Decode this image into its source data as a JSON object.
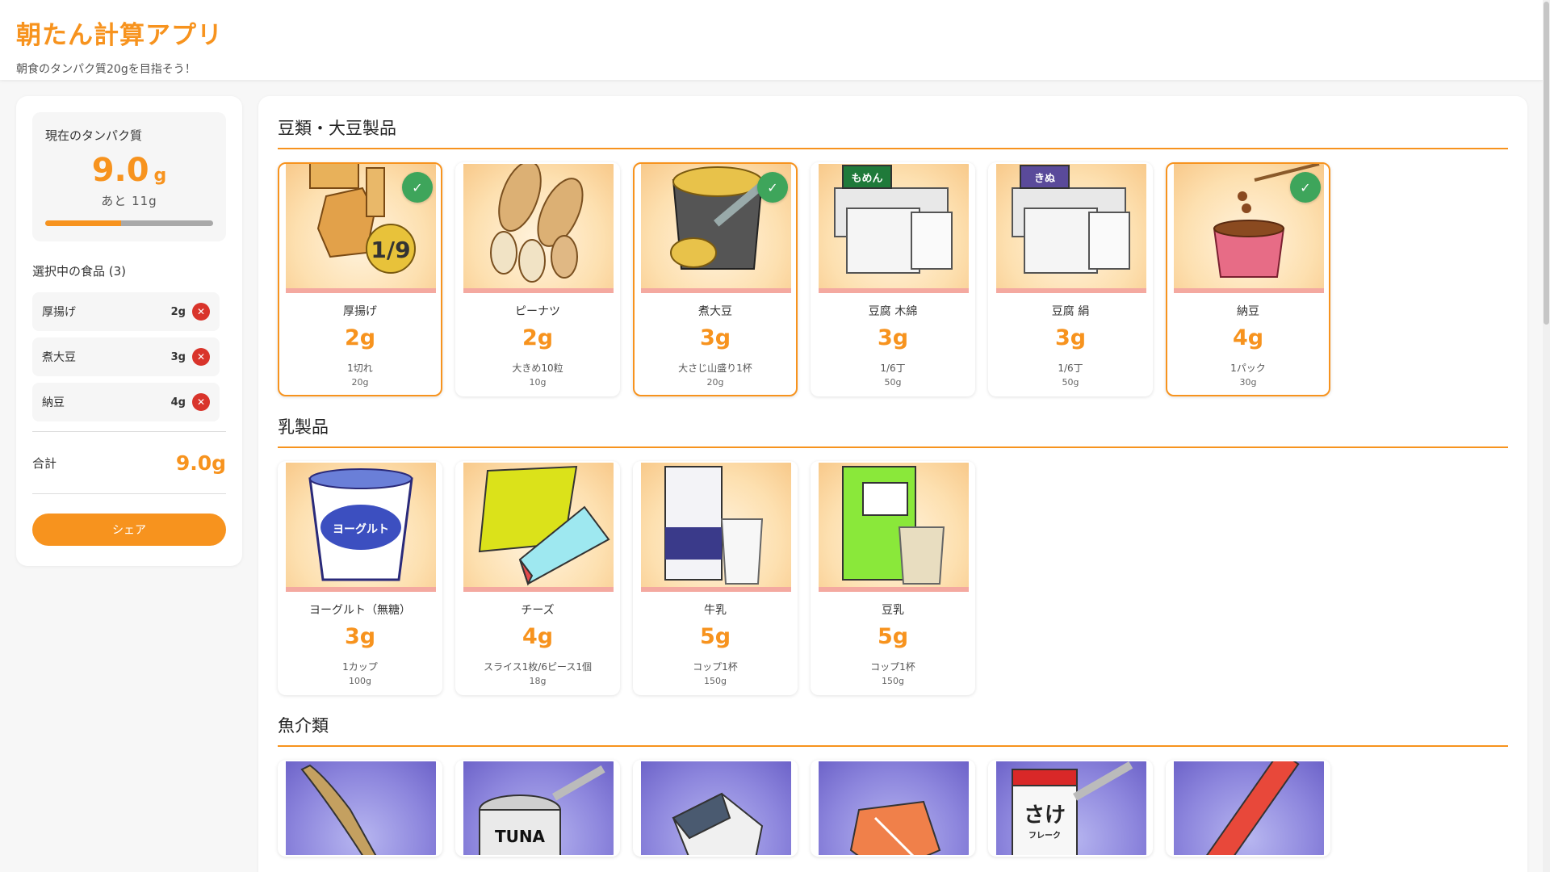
{
  "header": {
    "title": "朝たん計算アプリ",
    "subtitle": "朝食のタンパク質20gを目指そう！"
  },
  "sidebar": {
    "current_label": "現在のタンパク質",
    "current_value": "9.0",
    "current_unit": "g",
    "remaining": "あと 11g",
    "progress_fraction": 0.45,
    "selected_heading": "選択中の食品 (3)",
    "selected_items": [
      {
        "name": "厚揚げ",
        "grams": "2g"
      },
      {
        "name": "煮大豆",
        "grams": "3g"
      },
      {
        "name": "納豆",
        "grams": "4g"
      }
    ],
    "total_label": "合計",
    "total_value": "9.0g",
    "share_label": "シェア"
  },
  "categories": [
    {
      "title": "豆類・大豆製品",
      "items": [
        {
          "name": "厚揚げ",
          "protein": "2g",
          "portion": "1切れ",
          "weight": "20g",
          "selected": true,
          "icon": "atsuage-illustration",
          "image_label": "1/9"
        },
        {
          "name": "ピーナツ",
          "protein": "2g",
          "portion": "大きめ10粒",
          "weight": "10g",
          "selected": false,
          "icon": "peanut-illustration"
        },
        {
          "name": "煮大豆",
          "protein": "3g",
          "portion": "大さじ山盛り1杯",
          "weight": "20g",
          "selected": true,
          "icon": "boiled-soybean-illustration"
        },
        {
          "name": "豆腐 木綿",
          "protein": "3g",
          "portion": "1/6丁",
          "weight": "50g",
          "selected": false,
          "icon": "tofu-momen-illustration",
          "image_label": "もめん"
        },
        {
          "name": "豆腐 絹",
          "protein": "3g",
          "portion": "1/6丁",
          "weight": "50g",
          "selected": false,
          "icon": "tofu-kinu-illustration",
          "image_label": "きぬ"
        },
        {
          "name": "納豆",
          "protein": "4g",
          "portion": "1パック",
          "weight": "30g",
          "selected": true,
          "icon": "natto-illustration"
        }
      ]
    },
    {
      "title": "乳製品",
      "items": [
        {
          "name": "ヨーグルト（無糖）",
          "protein": "3g",
          "portion": "1カップ",
          "weight": "100g",
          "selected": false,
          "icon": "yogurt-illustration",
          "image_label": "ヨーグルト"
        },
        {
          "name": "チーズ",
          "protein": "4g",
          "portion": "スライス1枚/6ピース1個",
          "weight": "18g",
          "selected": false,
          "icon": "cheese-illustration"
        },
        {
          "name": "牛乳",
          "protein": "5g",
          "portion": "コップ1杯",
          "weight": "150g",
          "selected": false,
          "icon": "milk-illustration"
        },
        {
          "name": "豆乳",
          "protein": "5g",
          "portion": "コップ1杯",
          "weight": "150g",
          "selected": false,
          "icon": "soy-milk-illustration"
        }
      ]
    },
    {
      "title": "魚介類",
      "items": [
        {
          "icon": "eel-illustration"
        },
        {
          "icon": "tuna-can-illustration",
          "image_label": "TUNA"
        },
        {
          "icon": "fish-fillet-illustration"
        },
        {
          "icon": "salmon-illustration"
        },
        {
          "icon": "salmon-flakes-illustration",
          "image_label": "さけ",
          "image_sublabel": "フレーク"
        },
        {
          "icon": "crab-stick-illustration"
        }
      ]
    }
  ],
  "colors": {
    "accent": "#f7931e",
    "check": "#3ea55b",
    "remove": "#d9342b"
  }
}
